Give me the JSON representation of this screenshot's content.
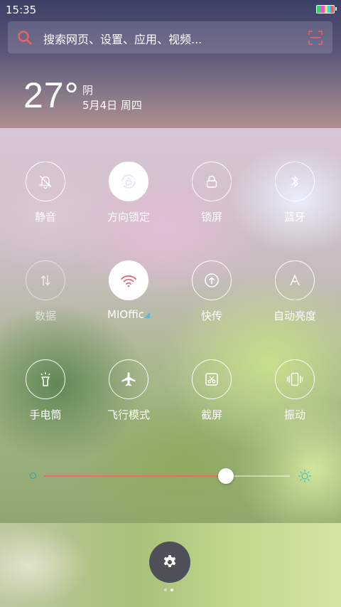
{
  "status": {
    "time": "15:35"
  },
  "search": {
    "placeholder": "搜索网页、设置、应用、视频..."
  },
  "weather": {
    "temperature": "27°",
    "condition": "阴",
    "date": "5月4日 周四"
  },
  "toggles": [
    {
      "label": "静音",
      "icon": "bell-slash-icon",
      "state": "off"
    },
    {
      "label": "方向锁定",
      "icon": "rotation-lock-icon",
      "state": "on"
    },
    {
      "label": "锁屏",
      "icon": "lock-icon",
      "state": "off"
    },
    {
      "label": "蓝牙",
      "icon": "bluetooth-icon",
      "state": "off"
    },
    {
      "label": "数据",
      "icon": "mobile-data-icon",
      "state": "disabled"
    },
    {
      "label": "MIOffic",
      "icon": "wifi-icon",
      "state": "on"
    },
    {
      "label": "快传",
      "icon": "quick-transfer-icon",
      "state": "off"
    },
    {
      "label": "自动亮度",
      "icon": "auto-brightness-icon",
      "state": "off"
    },
    {
      "label": "手电筒",
      "icon": "flashlight-icon",
      "state": "off"
    },
    {
      "label": "飞行模式",
      "icon": "airplane-icon",
      "state": "off"
    },
    {
      "label": "截屏",
      "icon": "screenshot-icon",
      "state": "off"
    },
    {
      "label": "振动",
      "icon": "vibrate-icon",
      "state": "off"
    }
  ],
  "brightness": {
    "level": 0.74
  },
  "colors": {
    "accent": "#ef6a66",
    "settings_bg": "#4d5058"
  },
  "pager": {
    "pages": 2,
    "current": 2
  }
}
